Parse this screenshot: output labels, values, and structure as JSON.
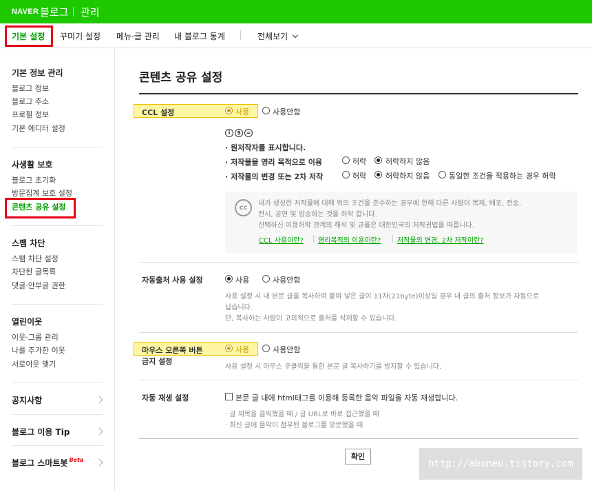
{
  "header": {
    "brand": "NAVER",
    "service": "블로그",
    "section": "관리"
  },
  "tabs": [
    {
      "label": "기본 설정"
    },
    {
      "label": "꾸미기 설정"
    },
    {
      "label": "메뉴·글 관리"
    },
    {
      "label": "내 블로그 통계"
    },
    {
      "label": "전체보기"
    }
  ],
  "sidebar": {
    "groups": [
      {
        "title": "기본 정보 관리",
        "items": [
          "블로그 정보",
          "블로그 주소",
          "프로필 정보",
          "기본 에디터 설정"
        ]
      },
      {
        "title": "사생활 보호",
        "items": [
          "블로그 초기화",
          "방문집계 보호 설정",
          "콘텐츠 공유 설정"
        ]
      },
      {
        "title": "스팸 차단",
        "items": [
          "스팸 차단 설정",
          "차단된 글목록",
          "댓글·안부글 권한"
        ]
      },
      {
        "title": "열린이웃",
        "items": [
          "이웃·그룹 관리",
          "나를 추가한 이웃",
          "서로이웃 맺기"
        ]
      }
    ],
    "links": [
      "공지사항",
      "블로그 이용 Tip",
      "블로그 스마트봇"
    ],
    "beta": "Beta"
  },
  "main": {
    "title": "콘텐츠 공유 설정",
    "ccl": {
      "label": "CCL 설정",
      "use": "사용",
      "nouse": "사용안함",
      "icons": [
        "i",
        "$",
        "="
      ],
      "line1": "· 원저작자를 표시합니다.",
      "line2": "· 저작물을 영리 목적으로 이용",
      "line3": "· 저작물의 변경 또는 2차 저작",
      "allow": "허락",
      "deny": "허락하지 않음",
      "same": "동일한 조건을 적용하는 경우 허락",
      "info1": "내가 생성한 저작물에 대해 위의 조건을 준수하는 경우에 한해 다른 사람이 복제, 배포, 전송,",
      "info2": "전시, 공연 및 방송하는 것을 허락 합니다.",
      "info3": "선택하신 이용허락 관계의 해석 및 규율은 대한민국의 저작권법을 따릅니다.",
      "link1": "CCL 사용이란?",
      "link2": "영리목적의 이용이란?",
      "link3": "저작물의 변경, 2차 저작이란?",
      "cc_badge": "cc"
    },
    "source": {
      "label": "자동출처 사용 설정",
      "use": "사용",
      "nouse": "사용안함",
      "desc1": "사용 설정 시 내 본문 글을 복사하여 붙여 넣은 글이 11자(21byte)이상일 경우 내 글의 출처 정보가 자동으로",
      "desc2": "납습니다.",
      "desc3": "단, 복사하는 사람이 고의적으로 출처를 삭제할 수 있습니다."
    },
    "rightclick": {
      "label1": "마우스 오른쪽 버튼",
      "label2": "금지 설정",
      "use": "사용",
      "nouse": "사용안함",
      "desc": "사용 설정 시 마우스 우클릭을 통한 본문 글 복사하기를 방지할 수 있습니다."
    },
    "autoplay": {
      "label": "자동 재생 설정",
      "checkbox": "본문 글 내에 html태그를 이용해 등록한 음악 파일을 자동 재생합니다.",
      "note1": "· 글 제목을 클릭했을 때 / 글 URL로 바로 접근했을 때",
      "note2": "· 최신 글에 음악이 첨부된 블로그를 방문했을 때"
    },
    "confirm": "확인"
  },
  "watermark": "http://aboneu.tistory.com",
  "colors": {
    "brand": "#1ec800",
    "highlight": "#fff6a3",
    "annotation": "#e60012",
    "link": "#00a000"
  }
}
